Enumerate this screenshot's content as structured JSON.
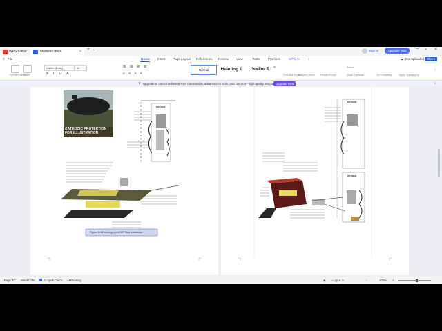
{
  "app": {
    "name": "WPS Office"
  },
  "tabs": {
    "doc_name": "Modules.docx"
  },
  "titlebar": {
    "signin": "Sign in",
    "upgrade": "Upgrade Now"
  },
  "menu": {
    "file": "File",
    "items": [
      "Home",
      "Insert",
      "Page Layout",
      "References",
      "Review",
      "View",
      "Tools",
      "Premium",
      "WPS AI"
    ],
    "active": "Home",
    "not_uploaded": "Not uploaded",
    "share": "Share"
  },
  "ribbon": {
    "font_name": "Calibri (Body)",
    "font_size": "10",
    "styles": [
      "Normal",
      "Heading 1",
      "Heading 2"
    ],
    "format_painter": "Format Painter",
    "paste": "Paste",
    "find_replace": "Find and Replace",
    "ai_spell": "AI Spell Check",
    "header_footer": "Header/Footer",
    "select": "Select",
    "quick_translate": "Quick Translate",
    "ai_formatting": "AI Formatting",
    "apply_typography": "Apply Typography"
  },
  "upgrade_bar": {
    "text": "Upgrade to unlock unlimited PDF functionality, advanced AI tools, and 100,000+ high-quality templates.",
    "button": "Upgrade Now"
  },
  "page1": {
    "photo_caption": "CATHODIC PROTECTION FOR ILLUSTRATION",
    "kitchen": "KITCHEN",
    "figure_caption": "Figure 11.11 Underground LPG Tank Installation"
  },
  "page2": {
    "kitchen": "KITCHEN",
    "kitchen2": "KITCHEN"
  },
  "status": {
    "page": "Page 3/7",
    "words": "Words: 293",
    "spell": "AI Spell Check",
    "proofing": "AI Proofing",
    "zoom": "100%"
  },
  "colors": {
    "accent": "#4a6cf7",
    "upgrade": "#6b4dea",
    "wps": "#e03a2f",
    "word_blue": "#2b5cd6"
  }
}
